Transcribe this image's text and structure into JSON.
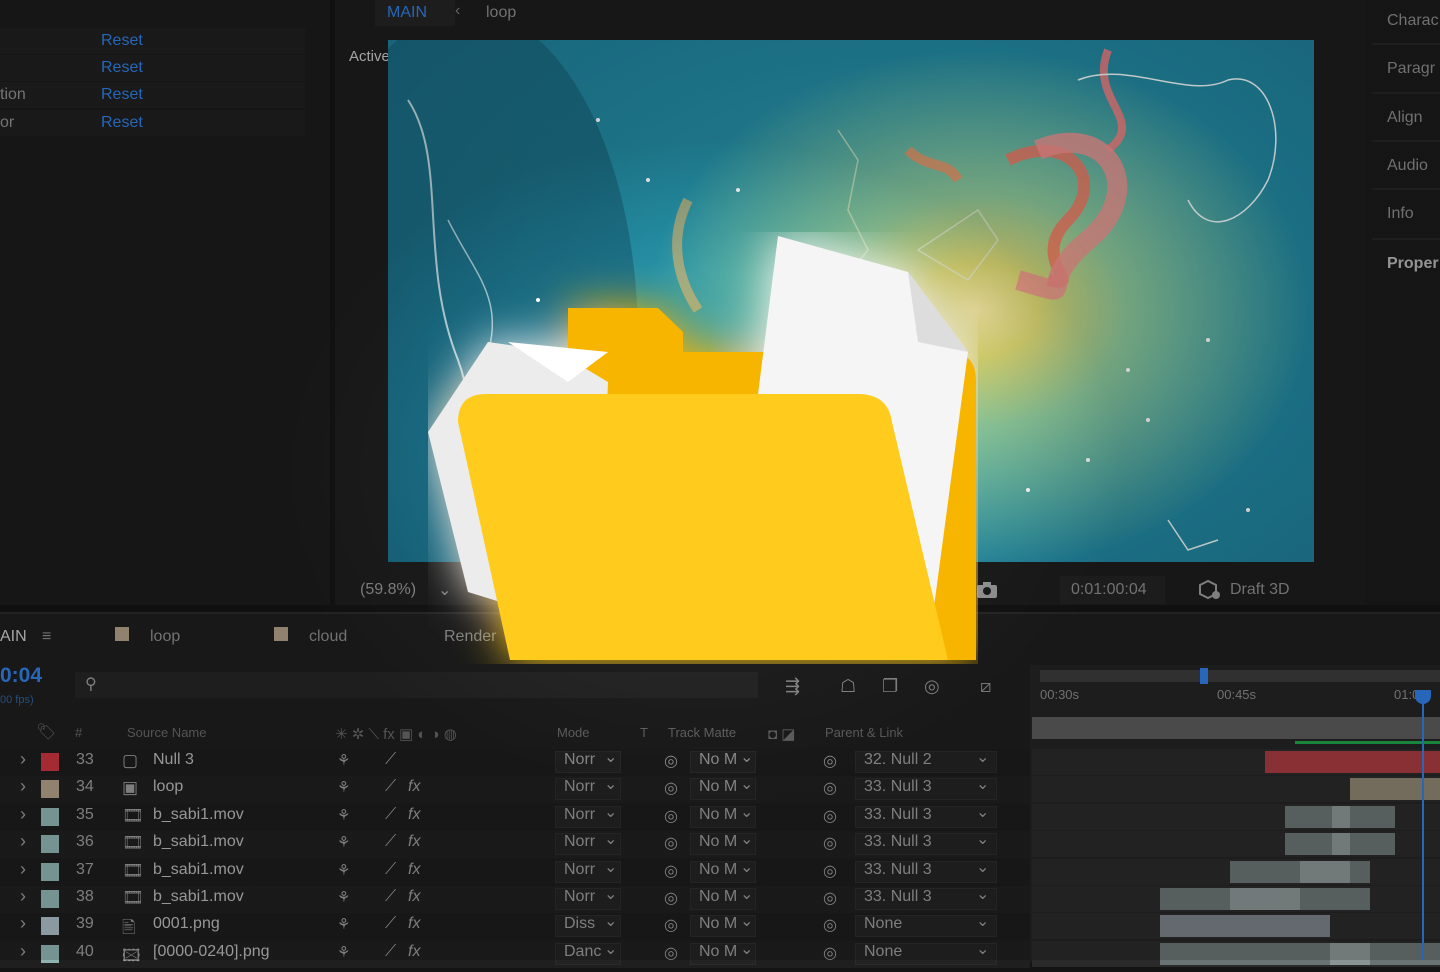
{
  "effect_controls": {
    "rows": [
      {
        "name": "",
        "reset": "Reset"
      },
      {
        "name": "",
        "reset": "Reset"
      },
      {
        "name": "tion",
        "reset": "Reset"
      },
      {
        "name": "or",
        "reset": "Reset"
      }
    ]
  },
  "viewer": {
    "tab_main": "MAIN",
    "tab_arrow": "‹",
    "tab_loop": "loop",
    "camera_label": "Active Camera (Default)",
    "zoom": "(59.8%)",
    "timecode": "0:01:00:04",
    "renderer": "Draft 3D"
  },
  "right_panel": {
    "items": [
      "Charac",
      "Paragr",
      "Align",
      "Audio",
      "Info",
      "Proper"
    ]
  },
  "timeline": {
    "tabs": {
      "main": "AIN",
      "loop": "loop",
      "cloud": "cloud",
      "render": "Render"
    },
    "current_time": "0:04",
    "fps": "00 fps)",
    "ruler": [
      "00:30s",
      "00:45s",
      "01:0"
    ],
    "headers": {
      "num": "#",
      "source_name": "Source Name",
      "mode": "Mode",
      "t": "T",
      "track_matte": "Track Matte",
      "parent": "Parent & Link"
    },
    "layers": [
      {
        "num": "33",
        "name": "Null 3",
        "label_color": "#c8343e",
        "icon": "null-icon",
        "mode": "Norr",
        "matte": "No M",
        "parent": "32. Null 2",
        "fx": false
      },
      {
        "num": "34",
        "name": "loop",
        "label_color": "#b09f86",
        "icon": "composition-icon",
        "mode": "Norr",
        "matte": "No M",
        "parent": "33. Null 3",
        "fx": true
      },
      {
        "num": "35",
        "name": "b_sabi1.mov",
        "label_color": "#8fb3b0",
        "icon": "film-icon",
        "mode": "Norr",
        "matte": "No M",
        "parent": "33. Null 3",
        "fx": true
      },
      {
        "num": "36",
        "name": "b_sabi1.mov",
        "label_color": "#8fb3b0",
        "icon": "film-icon",
        "mode": "Norr",
        "matte": "No M",
        "parent": "33. Null 3",
        "fx": true
      },
      {
        "num": "37",
        "name": "b_sabi1.mov",
        "label_color": "#8fb3b0",
        "icon": "film-icon",
        "mode": "Norr",
        "matte": "No M",
        "parent": "33. Null 3",
        "fx": true
      },
      {
        "num": "38",
        "name": "b_sabi1.mov",
        "label_color": "#8fb3b0",
        "icon": "film-icon",
        "mode": "Norr",
        "matte": "No M",
        "parent": "33. Null 3",
        "fx": true
      },
      {
        "num": "39",
        "name": "0001.png",
        "label_color": "#a9bcc4",
        "icon": "image-icon",
        "mode": "Diss",
        "matte": "No M",
        "parent": "None",
        "fx": true
      },
      {
        "num": "40",
        "name": "[0000-0240].png",
        "label_color": "#8fb3b0",
        "icon": "image-sequence-icon",
        "mode": "Danc",
        "matte": "No M",
        "parent": "None",
        "fx": true
      }
    ]
  },
  "colors": {
    "accent_blue": "#2f7de0",
    "folder_yellow": "#ffcb1f",
    "folder_back": "#f7b500"
  }
}
